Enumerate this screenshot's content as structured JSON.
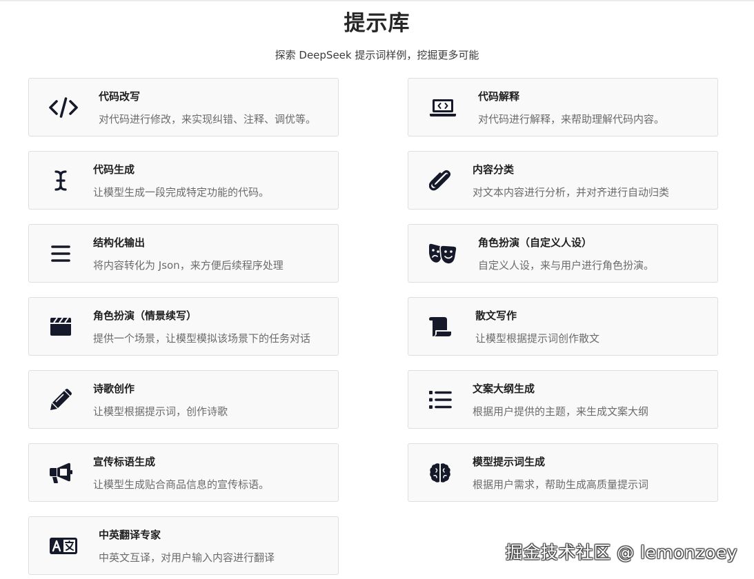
{
  "header": {
    "title": "提示库",
    "subtitle": "探索 DeepSeek 提示词样例，挖掘更多可能"
  },
  "prompts": [
    {
      "name": "代码改写",
      "desc": "对代码进行修改，来实现纠错、注释、调优等。",
      "icon": "code-icon"
    },
    {
      "name": "代码解释",
      "desc": "对代码进行解释，来帮助理解代码内容。",
      "icon": "laptop-code-icon"
    },
    {
      "name": "代码生成",
      "desc": "让模型生成一段完成特定功能的代码。",
      "icon": "text-cursor-icon"
    },
    {
      "name": "内容分类",
      "desc": "对文本内容进行分析，并对齐进行自动归类",
      "icon": "paperclip-icon"
    },
    {
      "name": "结构化输出",
      "desc": "将内容转化为 Json，来方便后续程序处理",
      "icon": "menu-bars-icon"
    },
    {
      "name": "角色扮演（自定义人设）",
      "desc": "自定义人设，来与用户进行角色扮演。",
      "icon": "theater-masks-icon"
    },
    {
      "name": "角色扮演（情景续写）",
      "desc": "提供一个场景，让模型模拟该场景下的任务对话",
      "icon": "clapperboard-icon"
    },
    {
      "name": "散文写作",
      "desc": "让模型根据提示词创作散文",
      "icon": "scroll-icon"
    },
    {
      "name": "诗歌创作",
      "desc": "让模型根据提示词，创作诗歌",
      "icon": "pencil-icon"
    },
    {
      "name": "文案大纲生成",
      "desc": "根据用户提供的主题，来生成文案大纲",
      "icon": "list-icon"
    },
    {
      "name": "宣传标语生成",
      "desc": "让模型生成贴合商品信息的宣传标语。",
      "icon": "bullhorn-icon"
    },
    {
      "name": "模型提示词生成",
      "desc": "根据用户需求，帮助生成高质量提示词",
      "icon": "brain-icon"
    },
    {
      "name": "中英翻译专家",
      "desc": "中英文互译，对用户输入内容进行翻译",
      "icon": "language-icon"
    }
  ],
  "watermark": "掘金技术社区 @ lemonzoey"
}
